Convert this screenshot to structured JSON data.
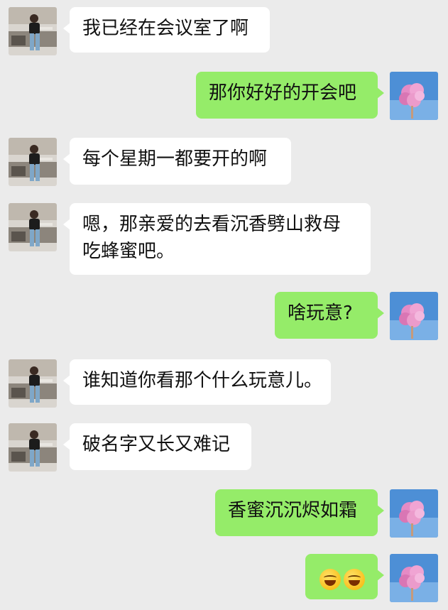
{
  "colors": {
    "background": "#ebebeb",
    "incoming_bubble": "#ffffff",
    "outgoing_bubble": "#95ec69"
  },
  "avatars": {
    "contact": "contact-avatar-photo",
    "me": "pink-flower-avatar-photo"
  },
  "messages": [
    {
      "side": "in",
      "text": "我已经在会议室了啊"
    },
    {
      "side": "out",
      "text": "那你好好的开会吧"
    },
    {
      "side": "in",
      "text": "每个星期一都要开的啊"
    },
    {
      "side": "in",
      "line1": "嗯，那亲爱的去看沉香劈山救母",
      "line2": "吃蜂蜜吧。"
    },
    {
      "side": "out",
      "text": "啥玩意?"
    },
    {
      "side": "in",
      "text": "谁知道你看那个什么玩意儿。"
    },
    {
      "side": "in",
      "text": "破名字又长又难记"
    },
    {
      "side": "out",
      "text": "香蜜沉沉烬如霜"
    },
    {
      "side": "out",
      "emojis": [
        "laughing-crying-emoji",
        "laughing-crying-emoji"
      ]
    }
  ]
}
